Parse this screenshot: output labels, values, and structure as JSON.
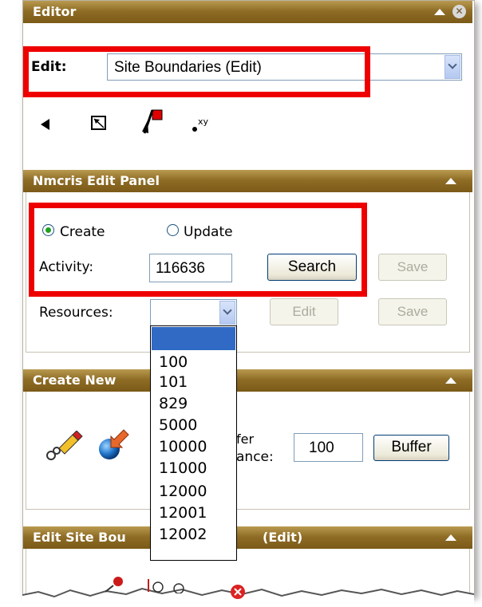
{
  "editor": {
    "title": "Editor",
    "edit_label": "Edit:",
    "edit_value": "Site Boundaries (Edit)",
    "tools": [
      "select-arrow-icon",
      "select-box-icon",
      "flag-icon",
      "xy-point-icon"
    ],
    "tool_xy_text": "xy"
  },
  "nmcris": {
    "title": "Nmcris Edit Panel",
    "radio_create": "Create",
    "radio_update": "Update",
    "selected_radio": "Create",
    "activity_label": "Activity:",
    "activity_value": "116636",
    "search_button": "Search",
    "save_button_1": "Save",
    "resources_label": "Resources:",
    "resources_value": "",
    "edit_button": "Edit",
    "save_button_2": "Save",
    "resources_options": [
      "",
      "100",
      "101",
      "829",
      "5000",
      "10000",
      "11000",
      "12000",
      "12001",
      "12002"
    ]
  },
  "create_new": {
    "title_visible": "Create New",
    "buffer_label_line1": "fer",
    "buffer_label_line2": "ance:",
    "buffer_value": "100",
    "buffer_button": "Buffer"
  },
  "edit_site": {
    "title_left": "Edit Site Bou",
    "title_right": "(Edit)"
  },
  "colors": {
    "header_top": "#b99a50",
    "header_bottom": "#7b5a18",
    "highlight_red": "#ee0000",
    "selection_blue": "#316ac5"
  }
}
